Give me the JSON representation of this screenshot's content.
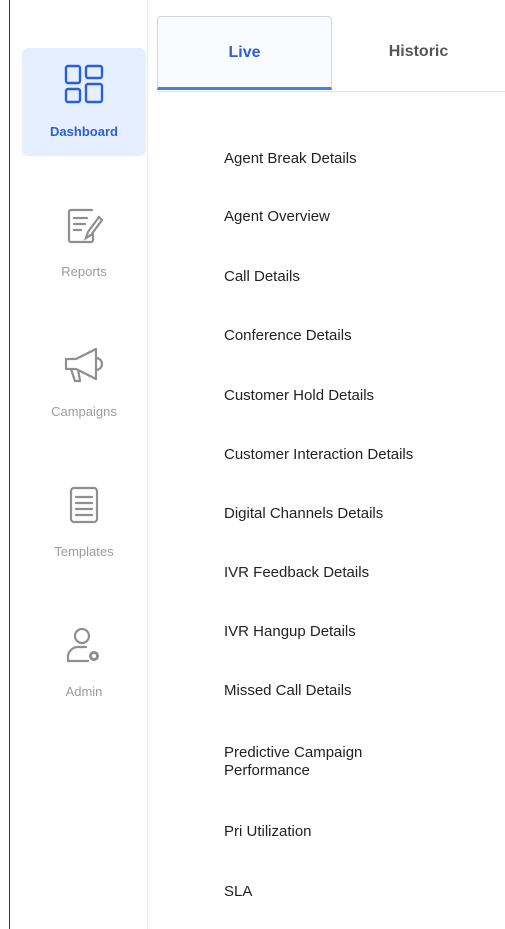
{
  "sidebar": {
    "items": [
      {
        "label": "Dashboard",
        "icon": "dashboard-grid-icon",
        "active": true
      },
      {
        "label": "Reports",
        "icon": "report-edit-icon",
        "active": false
      },
      {
        "label": "Campaigns",
        "icon": "megaphone-icon",
        "active": false
      },
      {
        "label": "Templates",
        "icon": "document-lines-icon",
        "active": false
      },
      {
        "label": "Admin",
        "icon": "user-gear-icon",
        "active": false
      }
    ]
  },
  "tabs": [
    {
      "label": "Live",
      "selected": true
    },
    {
      "label": "Historic",
      "selected": false
    }
  ],
  "reports": [
    "Agent Break Details",
    "Agent Overview",
    "Call Details",
    "Conference Details",
    "Customer Hold Details",
    "Customer Interaction Details",
    "Digital Channels Details",
    "IVR Feedback Details",
    "IVR Hangup Details",
    "Missed Call Details",
    "Predictive Campaign Performance",
    "Pri Utilization",
    "SLA"
  ],
  "colors": {
    "accent": "#2b5fd9",
    "active_bg": "#e6efff",
    "muted": "#9b9b9b"
  }
}
